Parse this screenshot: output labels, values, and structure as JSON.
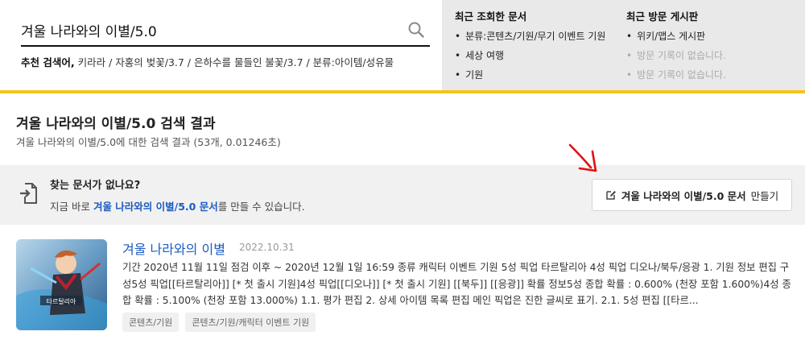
{
  "search": {
    "value": "겨울 나라와의 이별/5.0",
    "recommend_label": "추천 검색어,",
    "recommend_text": "키라라 / 자홍의 벚꽃/3.7 / 은하수를 물들인 불꽃/3.7 / 분류:아이템/성유물"
  },
  "recent": {
    "docs_title": "최근 조회한 문서",
    "docs": [
      "분류:콘텐츠/기원/무기 이벤트 기원",
      "세상 여행",
      "기원"
    ],
    "boards_title": "최근 방문 게시판",
    "boards": [
      "위키/맵스 게시판"
    ],
    "boards_empty": [
      "방문 기록이 없습니다.",
      "방문 기록이 없습니다."
    ]
  },
  "results": {
    "title": "겨울 나라와의 이별/5.0 검색 결과",
    "subtitle": "겨울 나라와의 이별/5.0에 대한 검색 결과 (53개, 0.01246초)"
  },
  "banner": {
    "question": "찾는 문서가 없나요?",
    "line_prefix": "지금 바로 ",
    "line_link": "겨울 나라와의 이별/5.0 문서",
    "line_suffix": "를 만들 수 있습니다.",
    "button_strong": "겨울 나라와의 이별/5.0 문서",
    "button_suffix": "만들기"
  },
  "item": {
    "title": "겨울 나라와의 이별",
    "date": "2022.10.31",
    "body": "기간 2020년 11월 11일 점검 이후 ~ 2020년 12월 1일 16:59 종류 캐릭터 이벤트 기원 5성 픽업 타르탈리아 4성 픽업 디오나/북두/응광 1. 기원 정보 편집 구성5성 픽업[[타르탈리아]] [* 첫 출시 기원]4성 픽업[[디오나]] [* 첫 출시 기원] [[북두]] [[응광]] 확률 정보5성 종합 확률 : 0.600% (천장 포함 1.600%)4성 종합 확률 : 5.100% (천장 포함 13.000%) 1.1. 평가 편집 2. 상세 아이템 목록 편집 메인 픽업은 진한 글씨로 표기. 2.1. 5성 편집 [[타르...",
    "tags": [
      "콘텐츠/기원",
      "콘텐츠/기원/캐릭터 이벤트 기원"
    ],
    "thumb_caption": "타르탈리아"
  },
  "colors": {
    "accent_yellow": "#f5c518",
    "link_blue": "#1a5bc4",
    "arrow_red": "#e01010"
  },
  "icons": [
    "search-icon",
    "document-import-icon",
    "edit-icon",
    "red-arrow-annotation"
  ]
}
